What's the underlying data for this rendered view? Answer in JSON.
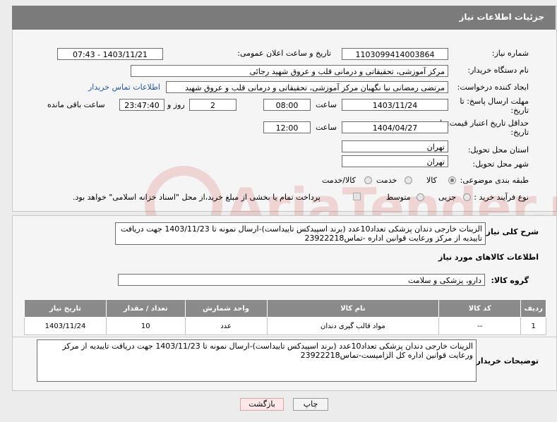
{
  "header": {
    "title": "جزئیات اطلاعات نیاز"
  },
  "fields": {
    "need_number_label": "شماره نیاز:",
    "need_number": "1103099414003864",
    "announce_label": "تاریخ و ساعت اعلان عمومی:",
    "announce_value": "1403/11/21 - 07:43",
    "buyer_label": "نام دستگاه خریدار:",
    "buyer_value": "مرکز آموزشی، تحقیقاتی و درمانی قلب و عروق شهید رجائی",
    "creator_label": "ایجاد کننده درخواست:",
    "creator_value": "مرتضی رمضانی نیا نگهبان مرکز آموزشی، تحقیقاتی و درمانی قلب و عروق شهید",
    "contact_link": "اطلاعات تماس خریدار",
    "deadline_label_1": "مهلت ارسال پاسخ: تا",
    "deadline_label_2": "تاریخ:",
    "deadline_date": "1403/11/24",
    "time_label": "ساعت",
    "deadline_time": "08:00",
    "days_value": "2",
    "days_label": "روز و",
    "remaining_time": "23:47:40",
    "remaining_label": "ساعت باقی مانده",
    "price_valid_label_1": "حداقل تاریخ اعتبار قیمت: تا",
    "price_valid_label_2": "تاریخ:",
    "price_valid_date": "1404/04/27",
    "price_valid_time": "12:00",
    "province_label": "استان محل تحویل:",
    "province_value": "تهران",
    "city_label": "شهر محل تحویل:",
    "city_value": "تهران",
    "category_label": "طبقه بندی موضوعی:",
    "category_options": [
      "کالا",
      "خدمت",
      "کالا/خدمت"
    ],
    "purchase_label": "نوع فرآیند خرید :",
    "purchase_options": [
      "جزیی",
      "متوسط"
    ],
    "payment_note": "پرداخت تمام یا بخشی از مبلغ خرید،از محل \"اسناد خزانه اسلامی\" خواهد بود."
  },
  "description": {
    "label": "شرح کلی نیاز:",
    "text": "الزینات خارجی دندان پزشکی تعداد10عدد (برند اسپیدکس تاییداست)-ارسال نمونه تا 1403/11/23 جهت دریافت تاییدیه از مرکز ورعایت قوانین اداره -تماس23922218"
  },
  "goods_section": {
    "title": "اطلاعات کالاهای مورد نیاز",
    "group_label": "گروه کالا:",
    "group_value": "دارو، پزشکی و سلامت"
  },
  "table": {
    "headers": [
      "ردیف",
      "کد کالا",
      "نام کالا",
      "واحد شمارش",
      "تعداد / مقدار",
      "تاریخ نیاز"
    ],
    "rows": [
      [
        "1",
        "--",
        "مواد قالب گیری دندان",
        "عدد",
        "10",
        "1403/11/24"
      ]
    ]
  },
  "buyer_notes": {
    "label": "توضیحات خریدار:",
    "text": "الزینات خارجی دندان پزشکی تعداد10عدد (برند اسپیدکس تاییداست)-ارسال نمونه تا 1403/11/23 جهت دریافت تاییدیه از مرکز ورعایت قوانین اداره کل الزامیست-تماس23922218"
  },
  "buttons": {
    "print": "چاپ",
    "back": "بازگشت"
  },
  "watermark": "AriaTender.neT"
}
